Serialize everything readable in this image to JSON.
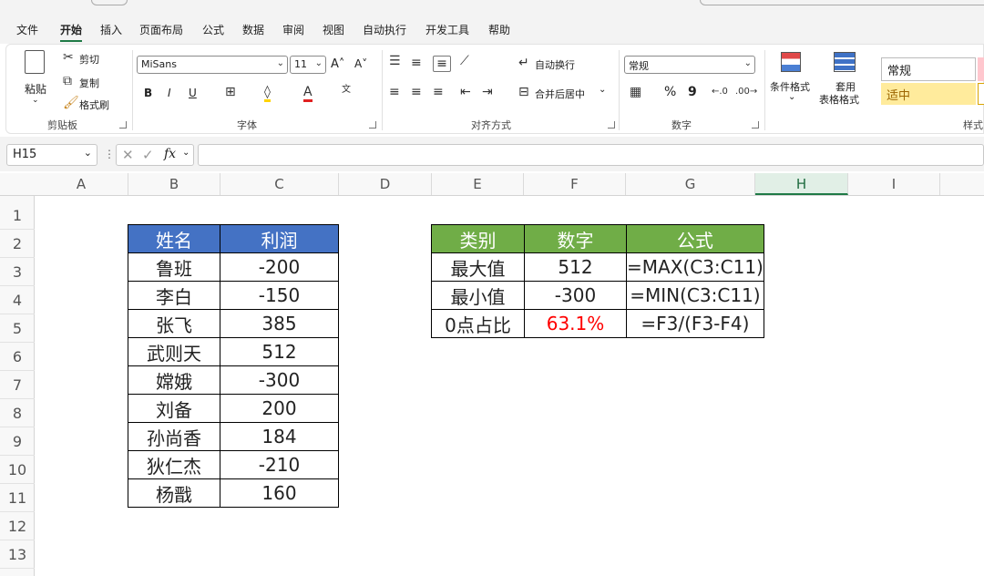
{
  "menu": {
    "tabs": [
      "文件",
      "开始",
      "插入",
      "页面布局",
      "公式",
      "数据",
      "审阅",
      "视图",
      "自动执行",
      "开发工具",
      "帮助"
    ],
    "active": "开始"
  },
  "ribbon": {
    "clipboard": {
      "paste": "粘贴",
      "cut": "剪切",
      "copy": "复制",
      "format_painter": "格式刷",
      "label": "剪贴板"
    },
    "font": {
      "name": "MiSans",
      "size": "11",
      "bold": "B",
      "italic": "I",
      "underline": "U",
      "label": "字体"
    },
    "alignment": {
      "wrap": "自动换行",
      "merge": "合并后居中",
      "label": "对齐方式"
    },
    "number": {
      "format": "常规",
      "label": "数字",
      "percent": "%",
      "comma": "9"
    },
    "styles": {
      "conditional": "条件格式",
      "table_format_1": "套用",
      "table_format_2": "表格格式",
      "normal": "常规",
      "neutral": "适中",
      "label": "样式"
    }
  },
  "formula_bar": {
    "name_box": "H15",
    "fx": "fx",
    "value": ""
  },
  "columns": [
    "A",
    "B",
    "C",
    "D",
    "E",
    "F",
    "G",
    "H",
    "I"
  ],
  "selected_column": "H",
  "rows": [
    "1",
    "2",
    "3",
    "4",
    "5",
    "6",
    "7",
    "8",
    "9",
    "10",
    "11",
    "12",
    "13"
  ],
  "left_table": {
    "headers": [
      "姓名",
      "利润"
    ],
    "rows": [
      [
        "鲁班",
        "-200"
      ],
      [
        "李白",
        "-150"
      ],
      [
        "张飞",
        "385"
      ],
      [
        "武则天",
        "512"
      ],
      [
        "嫦娥",
        "-300"
      ],
      [
        "刘备",
        "200"
      ],
      [
        "孙尚香",
        "184"
      ],
      [
        "狄仁杰",
        "-210"
      ],
      [
        "杨戬",
        "160"
      ]
    ]
  },
  "right_table": {
    "headers": [
      "类别",
      "数字",
      "公式"
    ],
    "rows": [
      [
        "最大值",
        "512",
        "=MAX(C3:C11)"
      ],
      [
        "最小值",
        "-300",
        "=MIN(C3:C11)"
      ],
      [
        "0点占比",
        "63.1%",
        "=F3/(F3-F4)"
      ]
    ],
    "highlight_color": "#ff0000"
  },
  "colors": {
    "left_header": "#4472c4",
    "right_header": "#70ad47",
    "accent": "#1f7a46"
  }
}
